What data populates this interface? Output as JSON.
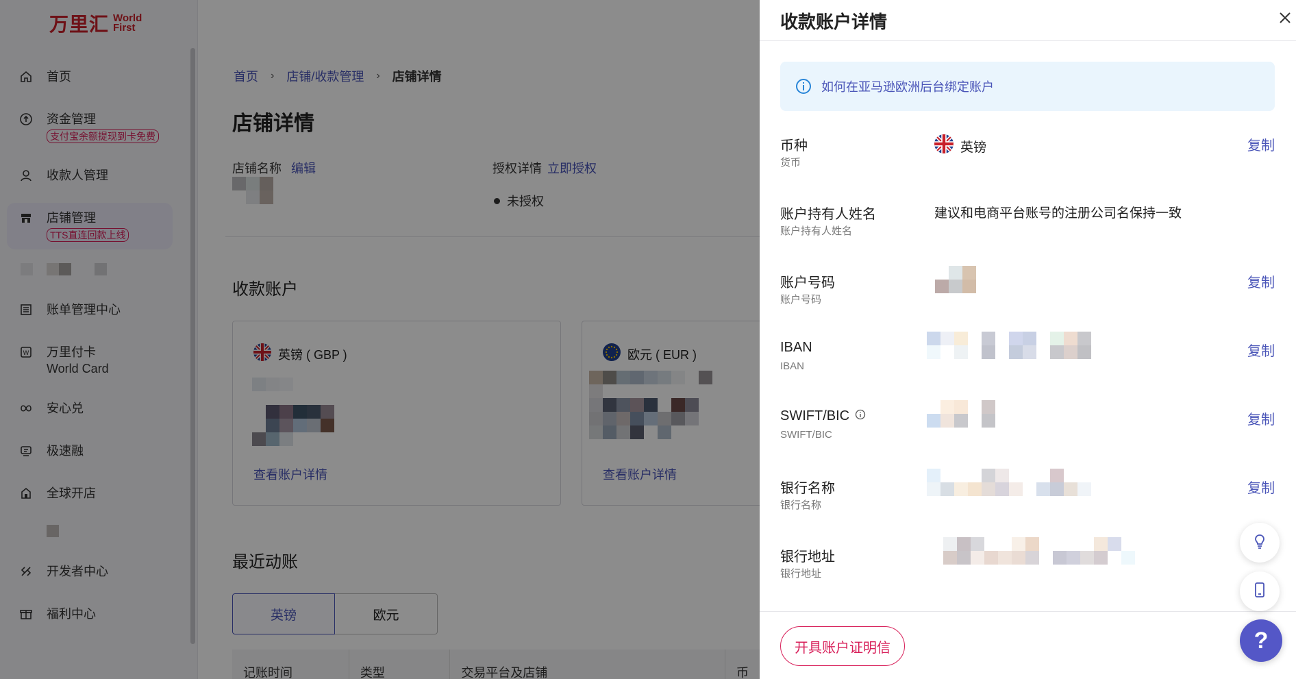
{
  "brand": {
    "logo_cn": "万里汇",
    "logo_en_1": "World",
    "logo_en_2": "First"
  },
  "sidebar": {
    "items": [
      {
        "label": "首页",
        "icon": "home-icon"
      },
      {
        "label": "资金管理",
        "icon": "funds-icon",
        "badge": "支付宝余额提现到卡免费"
      },
      {
        "label": "收款人管理",
        "icon": "user-icon"
      },
      {
        "label": "店铺管理",
        "icon": "store-icon",
        "badge": "TTS直连回款上线",
        "active": true
      },
      {
        "label": "账单管理中心",
        "icon": "bill-icon"
      },
      {
        "label": "万里付卡 World Card",
        "icon": "card-icon"
      },
      {
        "label": "安心兑",
        "icon": "exchange-icon"
      },
      {
        "label": "极速融",
        "icon": "loan-icon"
      },
      {
        "label": "全球开店",
        "icon": "shop-global-icon"
      },
      {
        "label": "开发者中心",
        "icon": "developer-icon"
      },
      {
        "label": "福利中心",
        "icon": "gift-icon"
      }
    ]
  },
  "main": {
    "breadcrumb": [
      "首页",
      "店铺/收款管理",
      "店铺详情"
    ],
    "title": "店铺详情",
    "shop_name_label": "店铺名称",
    "edit_link": "编辑",
    "auth_label": "授权详情",
    "auth_link": "立即授权",
    "auth_status": "未授权",
    "accounts_title": "收款账户",
    "account_cards": [
      {
        "currency": "英镑 ( GBP )",
        "view": "查看账户详情"
      },
      {
        "currency": "欧元 ( EUR )",
        "view": "查看账户详情"
      }
    ],
    "recent_title": "最近动账",
    "tabs": [
      "英镑",
      "欧元"
    ],
    "table_headers": [
      "记账时间",
      "类型",
      "交易平台及店铺",
      "币"
    ]
  },
  "drawer": {
    "title": "收款账户详情",
    "notice": "如何在亚马逊欧洲后台绑定账户",
    "copy_label": "复制",
    "fields": [
      {
        "label": "币种",
        "sub": "货币",
        "value": "英镑"
      },
      {
        "label": "账户持有人姓名",
        "sub": "账户持有人姓名",
        "value": "建议和电商平台账号的注册公司名保持一致"
      },
      {
        "label": "账户号码",
        "sub": "账户号码"
      },
      {
        "label": "IBAN",
        "sub": "IBAN"
      },
      {
        "label": "SWIFT/BIC",
        "sub": "SWIFT/BIC"
      },
      {
        "label": "银行名称",
        "sub": "银行名称"
      },
      {
        "label": "银行地址",
        "sub": "银行地址"
      }
    ],
    "footer_button": "开具账户证明信"
  },
  "float": {
    "help": "?"
  },
  "colors": {
    "accent": "#4a55b8",
    "brand": "#c8202a",
    "pink": "#d8205a"
  }
}
